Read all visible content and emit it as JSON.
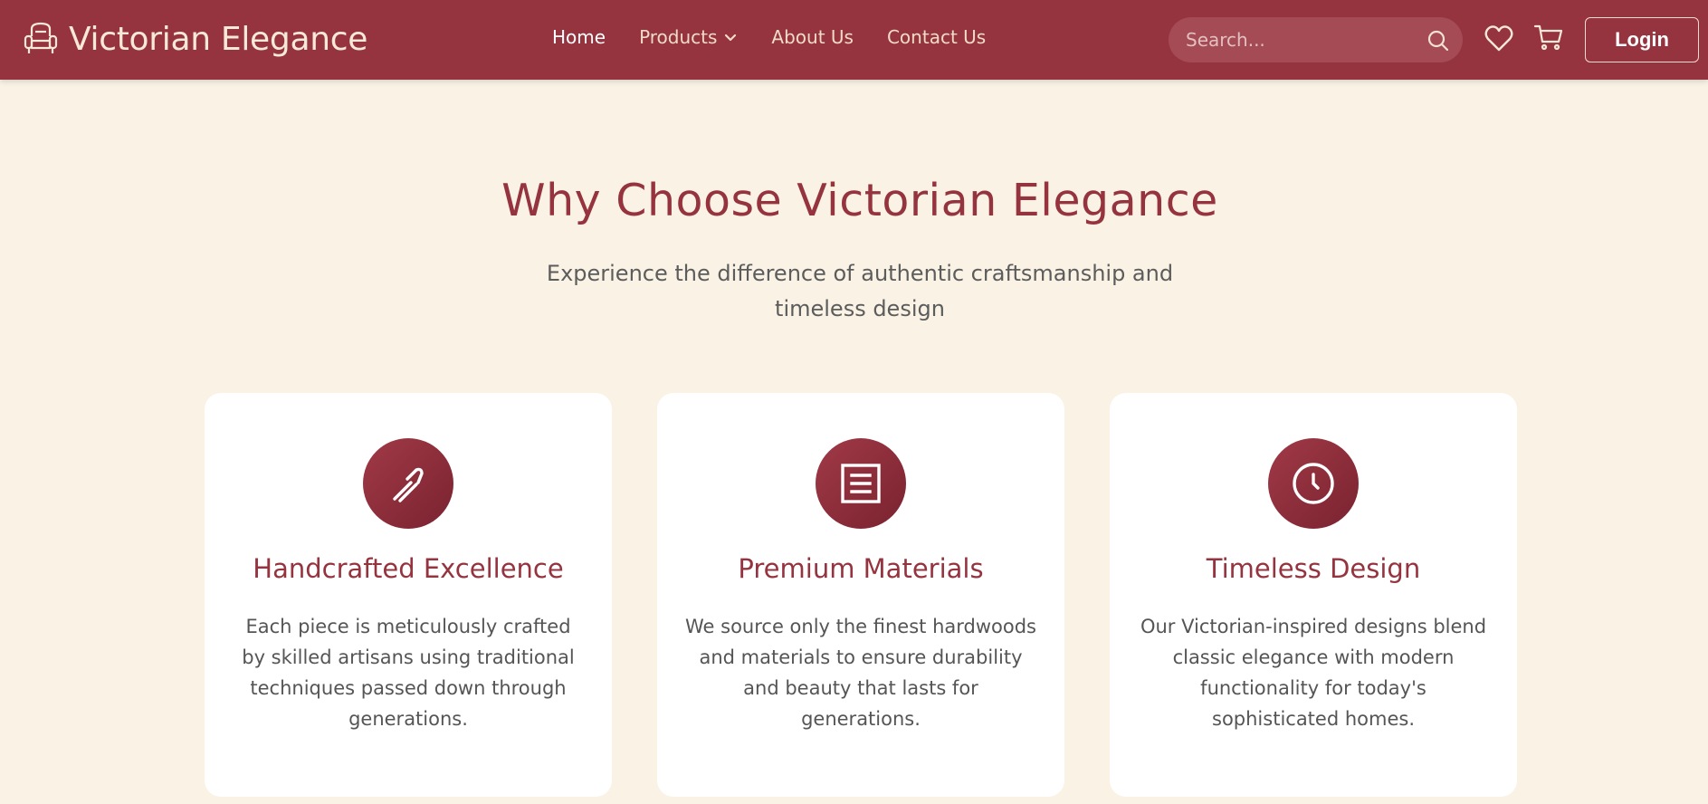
{
  "colors": {
    "brand": "#95333f",
    "background": "#f9f2e5",
    "card": "#ffffff"
  },
  "header": {
    "brand_name": "Victorian Elegance",
    "brand_icon": "armchair-icon",
    "nav": [
      {
        "label": "Home",
        "active": true
      },
      {
        "label": "Products",
        "has_dropdown": true
      },
      {
        "label": "About Us"
      },
      {
        "label": "Contact Us"
      }
    ],
    "search": {
      "placeholder": "Search...",
      "icon": "search-icon"
    },
    "wishlist_icon": "heart-icon",
    "cart_icon": "cart-icon",
    "login_label": "Login"
  },
  "section": {
    "title": "Why Choose Victorian Elegance",
    "subtitle": "Experience the difference of authentic craftsmanship and timeless design",
    "features": [
      {
        "icon": "hammer-icon",
        "title": "Handcrafted Excellence",
        "text": "Each piece is meticulously crafted by skilled artisans using traditional techniques passed down through generations."
      },
      {
        "icon": "document-icon",
        "title": "Premium Materials",
        "text": "We source only the finest hardwoods and materials to ensure durability and beauty that lasts for generations."
      },
      {
        "icon": "clock-icon",
        "title": "Timeless Design",
        "text": "Our Victorian-inspired designs blend classic elegance with modern functionality for today's sophisticated homes."
      }
    ]
  }
}
